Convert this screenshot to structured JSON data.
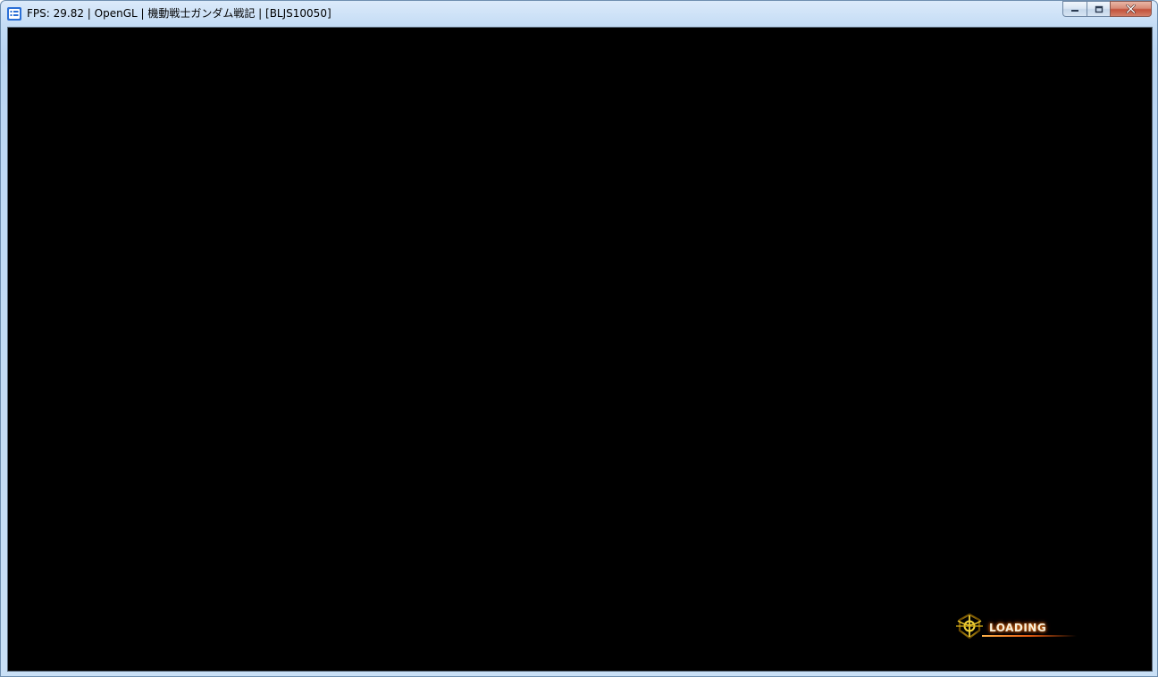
{
  "window": {
    "title": "FPS: 29.82 | OpenGL | 機動戦士ガンダム戦記 | [BLJS10050]",
    "icon": "rpcs3-app-icon",
    "buttons": {
      "minimize_icon": "minimize-icon",
      "restore_icon": "restore-icon",
      "close_icon": "close-icon"
    }
  },
  "game": {
    "loading_text": "LOADING",
    "loading_emblem": "zeon-emblem-icon",
    "accent_color": "#ff8a1a",
    "background_color": "#000000"
  }
}
